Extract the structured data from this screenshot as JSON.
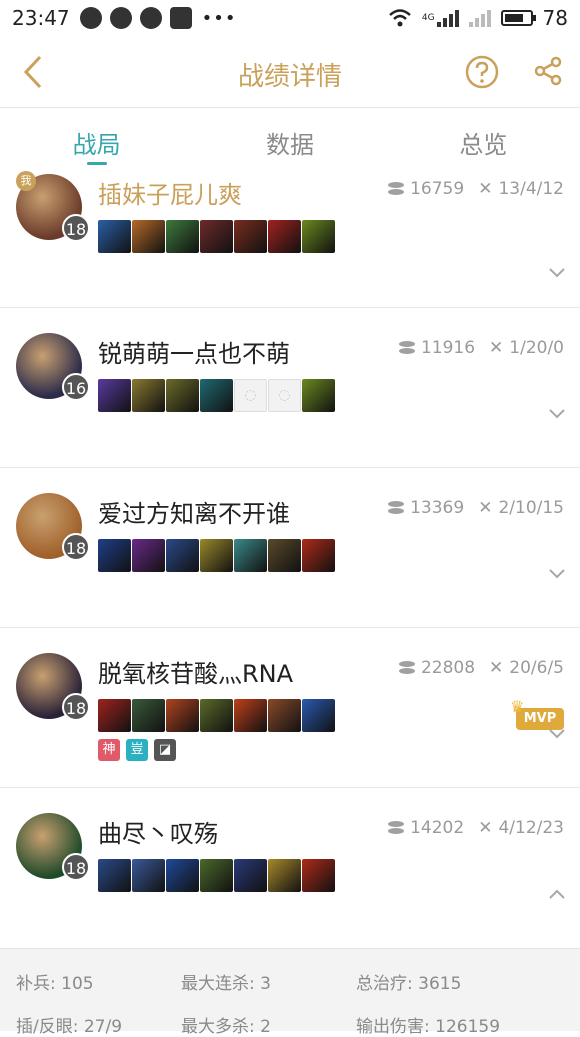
{
  "status_bar": {
    "time": "23:47",
    "network": "4G",
    "battery": "78",
    "battery_level": 0.78
  },
  "header": {
    "title": "战绩详情"
  },
  "tabs": [
    {
      "label": "战局",
      "active": true
    },
    {
      "label": "数据",
      "active": false
    },
    {
      "label": "总览",
      "active": false
    }
  ],
  "players": [
    {
      "name": "插妹子屁儿爽",
      "level": "18",
      "gold": "16759",
      "kda": "13/4/12",
      "self": true,
      "items": [
        "#2b5fa8",
        "#b76a2a",
        "#3e7a3e",
        "#6e2a2a",
        "#7a2d1f",
        "#a0231f",
        "#6a8a1f"
      ]
    },
    {
      "name": "锐萌萌一点也不萌",
      "level": "16",
      "gold": "11916",
      "kda": "1/20/0",
      "self": false,
      "items": [
        "#5a3aa0",
        "#8a7a30",
        "#6b6b2a",
        "#1f6a72",
        "empty",
        "empty",
        "#6a8a1f"
      ]
    },
    {
      "name": "爱过方知离不开谁",
      "level": "18",
      "gold": "13369",
      "kda": "2/10/15",
      "self": false,
      "items": [
        "#1f3f8a",
        "#6a2a8a",
        "#2a4a8a",
        "#9a8a2a",
        "#3a8a8a",
        "#5a4a2a",
        "#b02a1a"
      ]
    },
    {
      "name": "脱氧核苷酸灬RNA",
      "level": "18",
      "gold": "22808",
      "kda": "20/6/5",
      "self": false,
      "mvp": "MVP",
      "badges": [
        "神",
        "豈"
      ],
      "items": [
        "#a0231f",
        "#3a5a3a",
        "#b0441f",
        "#5a6a2a",
        "#c0401a",
        "#8a4a2a",
        "#2a5ab0"
      ]
    },
    {
      "name": "曲尽丶叹殇",
      "level": "18",
      "gold": "14202",
      "kda": "4/12/23",
      "self": false,
      "items": [
        "#2a4a8a",
        "#3a5a9a",
        "#1f4a9a",
        "#4a6a2a",
        "#2a3a7a",
        "#a88a2a",
        "#b02a1a"
      ]
    }
  ],
  "summary": {
    "row1": {
      "cs": "补兵: 105",
      "max_streak": "最大连杀: 3",
      "heal": "总治疗: 3615"
    },
    "row2": {
      "wards": "插/反眼: 27/9",
      "max_multi": "最大多杀: 2",
      "damage": "输出伤害: 126159"
    }
  },
  "colors": {
    "accent_gold": "#c9a15a",
    "accent_teal": "#37a7ad"
  }
}
